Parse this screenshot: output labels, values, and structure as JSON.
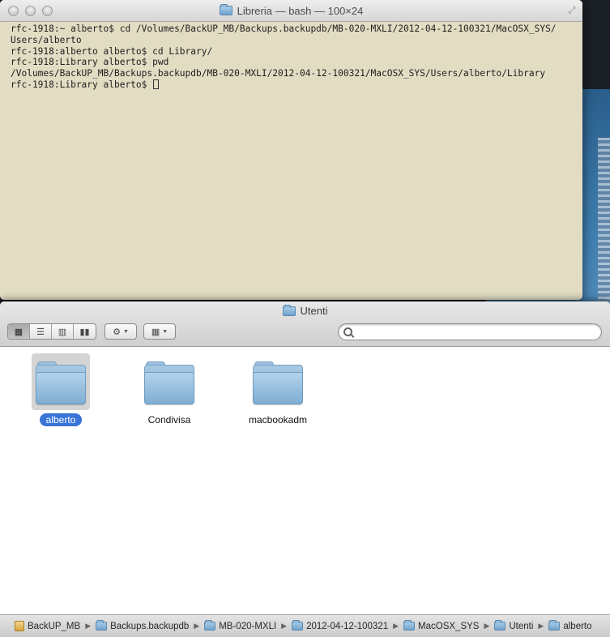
{
  "terminal": {
    "title": "Libreria — bash — 100×24",
    "lines": [
      "rfc-1918:~ alberto$ cd /Volumes/BackUP_MB/Backups.backupdb/MB-020-MXLI/2012-04-12-100321/MacOSX_SYS/",
      "Users/alberto",
      "rfc-1918:alberto alberto$ cd Library/",
      "rfc-1918:Library alberto$ pwd",
      "/Volumes/BackUP_MB/Backups.backupdb/MB-020-MXLI/2012-04-12-100321/MacOSX_SYS/Users/alberto/Library",
      "rfc-1918:Library alberto$ "
    ]
  },
  "finder": {
    "title": "Utenti",
    "search": {
      "value": "",
      "placeholder": ""
    },
    "items": [
      {
        "label": "alberto",
        "selected": true
      },
      {
        "label": "Condivisa",
        "selected": false
      },
      {
        "label": "macbookadm",
        "selected": false
      }
    ],
    "path": [
      {
        "label": "BackUP_MB",
        "icon": "disk-icon"
      },
      {
        "label": "Backups.backupdb",
        "icon": "folder-icon"
      },
      {
        "label": "MB-020-MXLI",
        "icon": "folder-icon"
      },
      {
        "label": "2012-04-12-100321",
        "icon": "folder-icon"
      },
      {
        "label": "MacOSX_SYS",
        "icon": "folder-icon"
      },
      {
        "label": "Utenti",
        "icon": "folder-icon"
      },
      {
        "label": "alberto",
        "icon": "folder-icon"
      }
    ]
  },
  "colors": {
    "terminal_bg": "#e2dcc3",
    "selection": "#3875d7"
  }
}
